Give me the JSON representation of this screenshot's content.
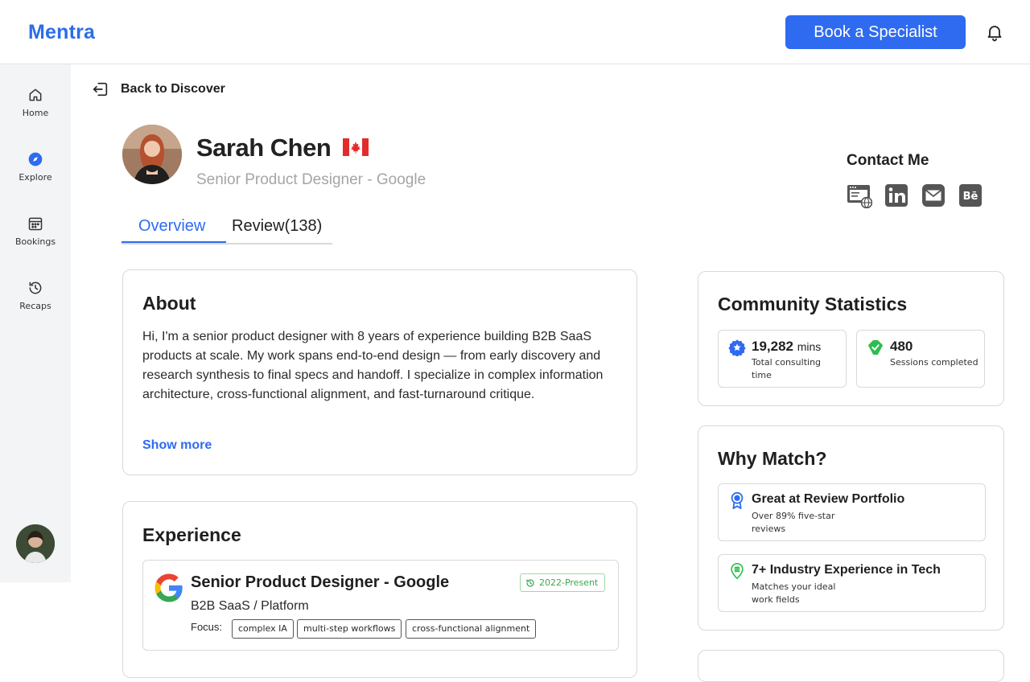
{
  "app": {
    "logo": "Mentra",
    "book_button": "Book a Specialist"
  },
  "sidebar": {
    "items": [
      {
        "label": "Home",
        "icon": "home-icon"
      },
      {
        "label": "Explore",
        "icon": "compass-icon"
      },
      {
        "label": "Bookings",
        "icon": "calendar-icon"
      },
      {
        "label": "Recaps",
        "icon": "history-icon"
      }
    ]
  },
  "nav": {
    "back_label": "Back to Discover"
  },
  "profile": {
    "name": "Sarah Chen",
    "role": "Senior Product Designer - Google",
    "country_flag": "canada-flag"
  },
  "tabs": [
    {
      "label": "Overview",
      "active": true
    },
    {
      "label": "Review(138)",
      "active": false
    }
  ],
  "contact": {
    "title": "Contact Me",
    "icons": [
      "website-icon",
      "linkedin-icon",
      "email-icon",
      "behance-icon"
    ]
  },
  "about": {
    "title": "About",
    "text": "Hi, I'm a senior product designer with 8 years of experience building B2B SaaS products at scale. My work spans end-to-end design — from early discovery and research synthesis to final specs and handoff. I specialize in complex information architecture, cross-functional alignment, and fast-turnaround critique.",
    "show_more": "Show more"
  },
  "experience": {
    "title": "Experience",
    "items": [
      {
        "title": "Senior Product Designer - Google",
        "subtitle": "B2B SaaS / Platform",
        "date": "2022-Present",
        "focus_label": "Focus:",
        "tags": [
          "complex IA",
          "multi-step workflows",
          "cross-functional alignment"
        ]
      }
    ]
  },
  "stats": {
    "title": "Community Statistics",
    "items": [
      {
        "value": "19,282",
        "unit": "mins",
        "label": "Total consulting time",
        "icon": "badge-star-icon",
        "color": "#2f6bf0"
      },
      {
        "value": "480",
        "unit": "",
        "label": "Sessions completed",
        "icon": "tag-icon",
        "color": "#2dbd4f"
      }
    ]
  },
  "why_match": {
    "title": "Why Match?",
    "items": [
      {
        "title": "Great at Review Portfolio",
        "subtitle": "Over 89% five-star reviews",
        "icon": "award-icon",
        "color": "#2f6bf0"
      },
      {
        "title": "7+ Industry Experience in Tech",
        "subtitle": "Matches your ideal work fields",
        "icon": "location-pin-icon",
        "color": "#2dbd4f"
      }
    ]
  },
  "colors": {
    "accent": "#2f6bf0",
    "success": "#2dbd4f",
    "border": "#d9d9d9"
  }
}
